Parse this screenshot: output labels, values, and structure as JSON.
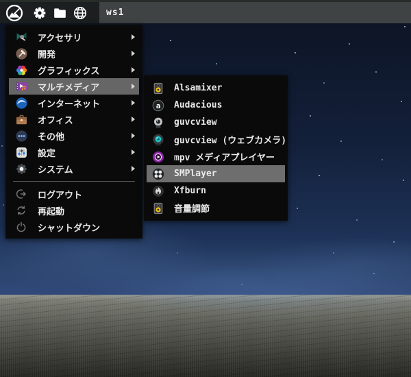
{
  "topbar": {
    "workspace_label": "ws1",
    "icons": [
      "mabox-logo",
      "gear",
      "folder",
      "globe"
    ]
  },
  "main_menu": {
    "items": [
      {
        "label": "アクセサリ",
        "icon": "accessories-category",
        "has_submenu": true
      },
      {
        "label": "開発",
        "icon": "development-category",
        "has_submenu": true
      },
      {
        "label": "グラフィックス",
        "icon": "graphics-category",
        "has_submenu": true
      },
      {
        "label": "マルチメディア",
        "icon": "multimedia-category",
        "has_submenu": true,
        "highlighted": true
      },
      {
        "label": "インターネット",
        "icon": "internet-category",
        "has_submenu": true
      },
      {
        "label": "オフィス",
        "icon": "office-category",
        "has_submenu": true
      },
      {
        "label": "その他",
        "icon": "other-category",
        "has_submenu": true
      },
      {
        "label": "設定",
        "icon": "settings-category",
        "has_submenu": true
      },
      {
        "label": "システム",
        "icon": "system-category",
        "has_submenu": true
      }
    ],
    "actions": [
      {
        "label": "ログアウト",
        "icon": "logout"
      },
      {
        "label": "再起動",
        "icon": "restart"
      },
      {
        "label": "シャットダウン",
        "icon": "shutdown"
      }
    ]
  },
  "submenu": {
    "items": [
      {
        "label": "Alsamixer",
        "icon": "speaker"
      },
      {
        "label": "Audacious",
        "icon": "audacious"
      },
      {
        "label": "guvcview",
        "icon": "webcam"
      },
      {
        "label": "guvcview (ウェブカメラ)",
        "icon": "webcam-alt"
      },
      {
        "label": "mpv メディアプレイヤー",
        "icon": "mpv"
      },
      {
        "label": "SMPlayer",
        "icon": "smplayer",
        "highlighted": true
      },
      {
        "label": "Xfburn",
        "icon": "xfburn"
      },
      {
        "label": "音量調節",
        "icon": "speaker"
      }
    ]
  },
  "colors": {
    "panel_left_bg": "#1b1f20",
    "panel_right_bg": "#3f4344",
    "menu_bg": "#0a0a0b",
    "highlight": "#666666",
    "text": "#e9e9e9",
    "sky_top": "#0c1322",
    "sky_horizon": "#31497a",
    "ground_light": "#84867e",
    "ground_dark": "#262722"
  }
}
